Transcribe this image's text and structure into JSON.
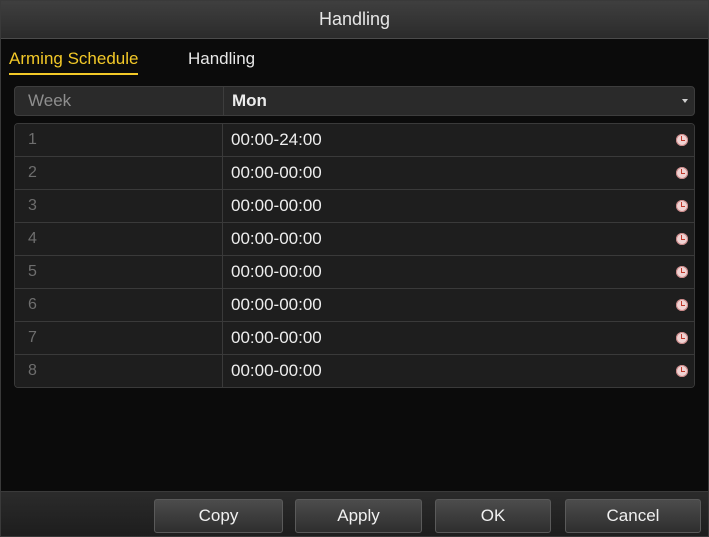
{
  "window": {
    "title": "Handling"
  },
  "tabs": [
    {
      "label": "Arming Schedule",
      "active": true
    },
    {
      "label": "Handling",
      "active": false
    }
  ],
  "week": {
    "label": "Week",
    "value": "Mon"
  },
  "schedule_rows": [
    {
      "num": "1",
      "time": "00:00-24:00"
    },
    {
      "num": "2",
      "time": "00:00-00:00"
    },
    {
      "num": "3",
      "time": "00:00-00:00"
    },
    {
      "num": "4",
      "time": "00:00-00:00"
    },
    {
      "num": "5",
      "time": "00:00-00:00"
    },
    {
      "num": "6",
      "time": "00:00-00:00"
    },
    {
      "num": "7",
      "time": "00:00-00:00"
    },
    {
      "num": "8",
      "time": "00:00-00:00"
    }
  ],
  "buttons": {
    "copy": "Copy",
    "apply": "Apply",
    "ok": "OK",
    "cancel": "Cancel"
  },
  "colors": {
    "accent": "#f3c928",
    "background": "#0b0b0b",
    "row": "#1e1e1e"
  },
  "icons": {
    "row_action": "clock-icon",
    "dropdown": "chevron-down-icon"
  }
}
